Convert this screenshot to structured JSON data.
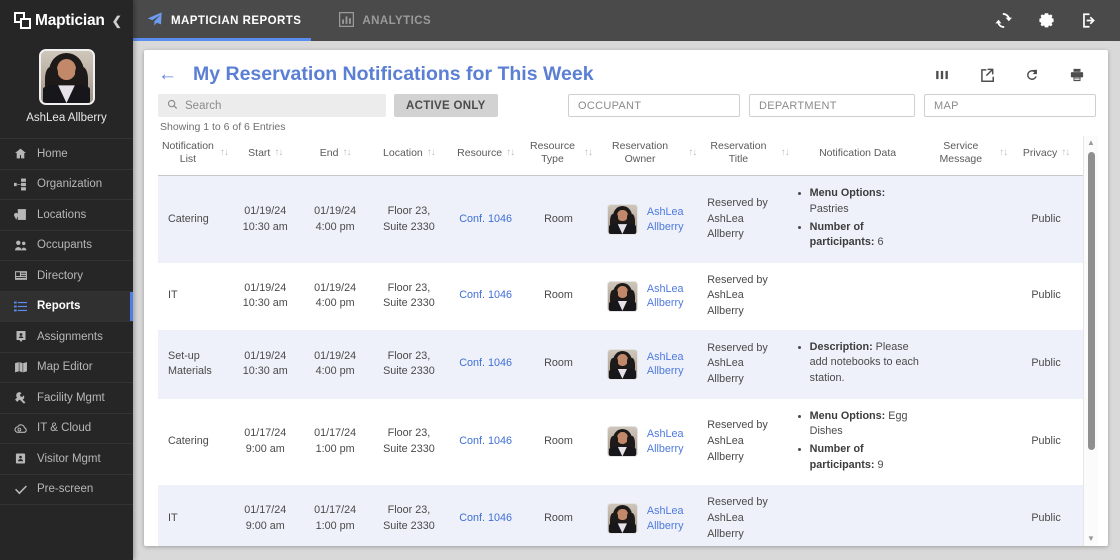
{
  "sidebar": {
    "brand": "Maptician",
    "collapse_icon": "chevron-left-icon",
    "profile_name": "AshLea Allberry",
    "items": [
      {
        "label": "Home",
        "icon": "home-icon",
        "active": false
      },
      {
        "label": "Organization",
        "icon": "org-chart-icon",
        "active": false
      },
      {
        "label": "Locations",
        "icon": "building-pin-icon",
        "active": false
      },
      {
        "label": "Occupants",
        "icon": "people-icon",
        "active": false
      },
      {
        "label": "Directory",
        "icon": "id-card-icon",
        "active": false
      },
      {
        "label": "Reports",
        "icon": "list-icon",
        "active": true
      },
      {
        "label": "Assignments",
        "icon": "person-card-icon",
        "active": false
      },
      {
        "label": "Map Editor",
        "icon": "map-icon",
        "active": false
      },
      {
        "label": "Facility Mgmt",
        "icon": "wrench-gear-icon",
        "active": false
      },
      {
        "label": "IT & Cloud",
        "icon": "cloud-gear-icon",
        "active": false
      },
      {
        "label": "Visitor Mgmt",
        "icon": "badge-icon",
        "active": false
      },
      {
        "label": "Pre-screen",
        "icon": "check-icon",
        "active": false
      }
    ]
  },
  "topbar": {
    "tabs": [
      {
        "label": "MAPTICIAN REPORTS",
        "icon": "paper-plane-icon",
        "active": true
      },
      {
        "label": "ANALYTICS",
        "icon": "bar-chart-icon",
        "active": false
      }
    ],
    "actions": [
      {
        "name": "sync-icon"
      },
      {
        "name": "gear-icon"
      },
      {
        "name": "logout-icon"
      }
    ]
  },
  "page": {
    "back_icon": "arrow-left-icon",
    "title": "My Reservation Notifications for This Week",
    "actions": [
      {
        "name": "columns-icon"
      },
      {
        "name": "export-icon"
      },
      {
        "name": "refresh-icon"
      },
      {
        "name": "print-icon"
      }
    ]
  },
  "filters": {
    "search_placeholder": "Search",
    "search_value": "",
    "search_icon": "search-icon",
    "active_only_label": "ACTIVE ONLY",
    "occupant_value": "OCCUPANT",
    "department_value": "DEPARTMENT",
    "map_value": "MAP"
  },
  "showing_text": "Showing 1 to 6 of 6 Entries",
  "table": {
    "columns": [
      {
        "label": "Notification List",
        "sortable": true
      },
      {
        "label": "Start",
        "sortable": true
      },
      {
        "label": "End",
        "sortable": true
      },
      {
        "label": "Location",
        "sortable": true
      },
      {
        "label": "Resource",
        "sortable": true
      },
      {
        "label": "Resource Type",
        "sortable": true
      },
      {
        "label": "Reservation Owner",
        "sortable": true
      },
      {
        "label": "Reservation Title",
        "sortable": true
      },
      {
        "label": "Notification Data",
        "sortable": false
      },
      {
        "label": "Service Message",
        "sortable": true
      },
      {
        "label": "Privacy",
        "sortable": true
      }
    ],
    "sort_glyph": "↑↓",
    "rows": [
      {
        "notification_list": "Catering",
        "start": "01/19/24\n10:30 am",
        "end": "01/19/24\n4:00 pm",
        "location": "Floor 23,\nSuite 2330",
        "resource": "Conf. 1046",
        "resource_type": "Room",
        "owner": "AshLea Allberry",
        "reservation_title": "Reserved by AshLea Allberry",
        "notification_data": [
          {
            "key": "Menu Options:",
            "value": " Pastries"
          },
          {
            "key": "Number of participants:",
            "value": " 6"
          }
        ],
        "service_message": "",
        "privacy": "Public"
      },
      {
        "notification_list": "IT",
        "start": "01/19/24\n10:30 am",
        "end": "01/19/24\n4:00 pm",
        "location": "Floor 23,\nSuite 2330",
        "resource": "Conf. 1046",
        "resource_type": "Room",
        "owner": "AshLea Allberry",
        "reservation_title": "Reserved by AshLea Allberry",
        "notification_data": [],
        "service_message": "",
        "privacy": "Public"
      },
      {
        "notification_list": "Set-up Materials",
        "start": "01/19/24\n10:30 am",
        "end": "01/19/24\n4:00 pm",
        "location": "Floor 23,\nSuite 2330",
        "resource": "Conf. 1046",
        "resource_type": "Room",
        "owner": "AshLea Allberry",
        "reservation_title": "Reserved by AshLea Allberry",
        "notification_data": [
          {
            "key": "Description:",
            "value": " Please add notebooks to each station."
          }
        ],
        "service_message": "",
        "privacy": "Public"
      },
      {
        "notification_list": "Catering",
        "start": "01/17/24\n9:00 am",
        "end": "01/17/24\n1:00 pm",
        "location": "Floor 23,\nSuite 2330",
        "resource": "Conf. 1046",
        "resource_type": "Room",
        "owner": "AshLea Allberry",
        "reservation_title": "Reserved by AshLea Allberry",
        "notification_data": [
          {
            "key": "Menu Options:",
            "value": " Egg Dishes"
          },
          {
            "key": "Number of participants:",
            "value": " 9"
          }
        ],
        "service_message": "",
        "privacy": "Public"
      },
      {
        "notification_list": "IT",
        "start": "01/17/24\n9:00 am",
        "end": "01/17/24\n1:00 pm",
        "location": "Floor 23,\nSuite 2330",
        "resource": "Conf. 1046",
        "resource_type": "Room",
        "owner": "AshLea Allberry",
        "reservation_title": "Reserved by AshLea Allberry",
        "notification_data": [],
        "service_message": "",
        "privacy": "Public"
      }
    ]
  },
  "colors": {
    "accent_blue": "#5b8def",
    "title_blue": "#5b7fd4",
    "link_blue": "#3f6fd8",
    "sidebar_bg": "#262626",
    "topbar_bg": "#4a4a4a",
    "row_alt": "#eef1f9"
  }
}
